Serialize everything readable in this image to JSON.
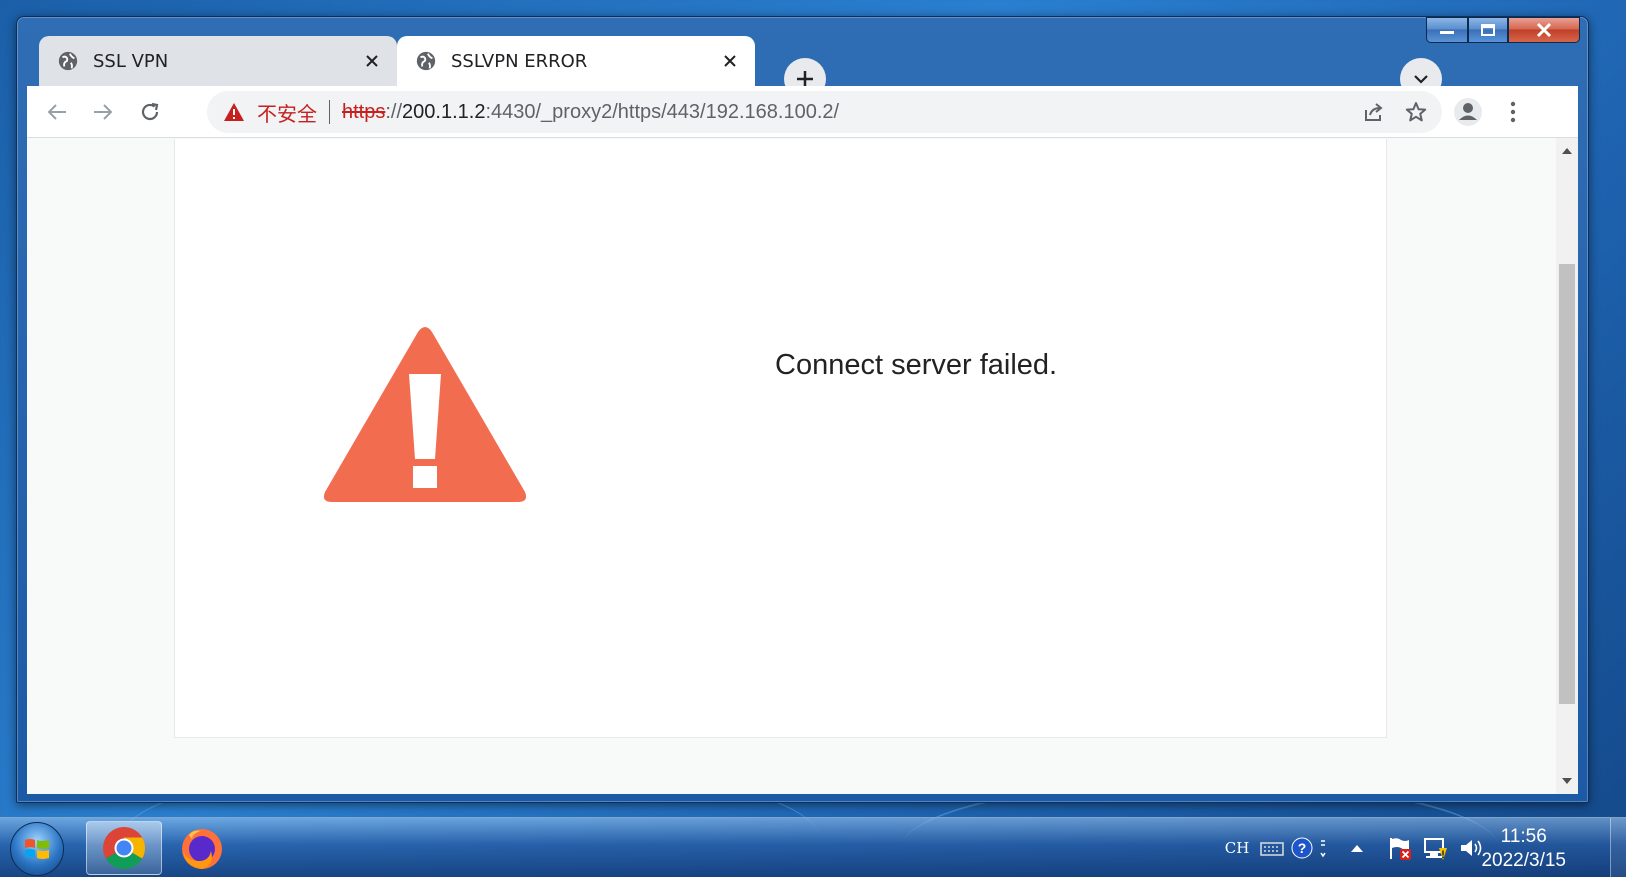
{
  "colors": {
    "insecure_red": "#c5221f",
    "warning_orange": "#f26c4f",
    "desktop_blue": "#1b5fa8"
  },
  "window": {
    "controls": {
      "minimize_icon": "minimize-icon",
      "maximize_icon": "maximize-icon",
      "close_icon": "close-icon"
    }
  },
  "tabs": [
    {
      "title": "SSL VPN",
      "icon": "globe-icon",
      "active": false
    },
    {
      "title": "SSLVPN ERROR",
      "icon": "globe-icon",
      "active": true
    }
  ],
  "toolbar": {
    "back_icon": "back-arrow-icon",
    "forward_icon": "forward-arrow-icon",
    "reload_icon": "reload-icon",
    "security_label": "不安全",
    "url": {
      "scheme": "https",
      "separator": "://",
      "host": "200.1.1.2",
      "rest": ":4430/_proxy2/https/443/192.168.100.2/"
    },
    "share_icon": "share-icon",
    "bookmark_icon": "star-icon",
    "profile_icon": "profile-icon",
    "menu_icon": "kebab-menu-icon"
  },
  "page": {
    "error_icon": "warning-triangle-icon",
    "message": "Connect server failed."
  },
  "taskbar": {
    "pinned": [
      {
        "name": "chrome-icon",
        "active": true
      },
      {
        "name": "firefox-icon",
        "active": false
      }
    ],
    "tray": {
      "language": "CH",
      "time": "11:56",
      "date": "2022/3/15"
    }
  }
}
